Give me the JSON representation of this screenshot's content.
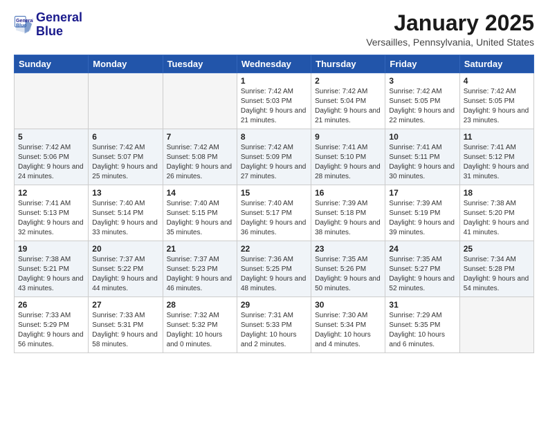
{
  "logo": {
    "line1": "General",
    "line2": "Blue"
  },
  "header": {
    "month": "January 2025",
    "location": "Versailles, Pennsylvania, United States"
  },
  "weekdays": [
    "Sunday",
    "Monday",
    "Tuesday",
    "Wednesday",
    "Thursday",
    "Friday",
    "Saturday"
  ],
  "weeks": [
    [
      {
        "day": "",
        "info": ""
      },
      {
        "day": "",
        "info": ""
      },
      {
        "day": "",
        "info": ""
      },
      {
        "day": "1",
        "info": "Sunrise: 7:42 AM\nSunset: 5:03 PM\nDaylight: 9 hours\nand 21 minutes."
      },
      {
        "day": "2",
        "info": "Sunrise: 7:42 AM\nSunset: 5:04 PM\nDaylight: 9 hours\nand 21 minutes."
      },
      {
        "day": "3",
        "info": "Sunrise: 7:42 AM\nSunset: 5:05 PM\nDaylight: 9 hours\nand 22 minutes."
      },
      {
        "day": "4",
        "info": "Sunrise: 7:42 AM\nSunset: 5:05 PM\nDaylight: 9 hours\nand 23 minutes."
      }
    ],
    [
      {
        "day": "5",
        "info": "Sunrise: 7:42 AM\nSunset: 5:06 PM\nDaylight: 9 hours\nand 24 minutes."
      },
      {
        "day": "6",
        "info": "Sunrise: 7:42 AM\nSunset: 5:07 PM\nDaylight: 9 hours\nand 25 minutes."
      },
      {
        "day": "7",
        "info": "Sunrise: 7:42 AM\nSunset: 5:08 PM\nDaylight: 9 hours\nand 26 minutes."
      },
      {
        "day": "8",
        "info": "Sunrise: 7:42 AM\nSunset: 5:09 PM\nDaylight: 9 hours\nand 27 minutes."
      },
      {
        "day": "9",
        "info": "Sunrise: 7:41 AM\nSunset: 5:10 PM\nDaylight: 9 hours\nand 28 minutes."
      },
      {
        "day": "10",
        "info": "Sunrise: 7:41 AM\nSunset: 5:11 PM\nDaylight: 9 hours\nand 30 minutes."
      },
      {
        "day": "11",
        "info": "Sunrise: 7:41 AM\nSunset: 5:12 PM\nDaylight: 9 hours\nand 31 minutes."
      }
    ],
    [
      {
        "day": "12",
        "info": "Sunrise: 7:41 AM\nSunset: 5:13 PM\nDaylight: 9 hours\nand 32 minutes."
      },
      {
        "day": "13",
        "info": "Sunrise: 7:40 AM\nSunset: 5:14 PM\nDaylight: 9 hours\nand 33 minutes."
      },
      {
        "day": "14",
        "info": "Sunrise: 7:40 AM\nSunset: 5:15 PM\nDaylight: 9 hours\nand 35 minutes."
      },
      {
        "day": "15",
        "info": "Sunrise: 7:40 AM\nSunset: 5:17 PM\nDaylight: 9 hours\nand 36 minutes."
      },
      {
        "day": "16",
        "info": "Sunrise: 7:39 AM\nSunset: 5:18 PM\nDaylight: 9 hours\nand 38 minutes."
      },
      {
        "day": "17",
        "info": "Sunrise: 7:39 AM\nSunset: 5:19 PM\nDaylight: 9 hours\nand 39 minutes."
      },
      {
        "day": "18",
        "info": "Sunrise: 7:38 AM\nSunset: 5:20 PM\nDaylight: 9 hours\nand 41 minutes."
      }
    ],
    [
      {
        "day": "19",
        "info": "Sunrise: 7:38 AM\nSunset: 5:21 PM\nDaylight: 9 hours\nand 43 minutes."
      },
      {
        "day": "20",
        "info": "Sunrise: 7:37 AM\nSunset: 5:22 PM\nDaylight: 9 hours\nand 44 minutes."
      },
      {
        "day": "21",
        "info": "Sunrise: 7:37 AM\nSunset: 5:23 PM\nDaylight: 9 hours\nand 46 minutes."
      },
      {
        "day": "22",
        "info": "Sunrise: 7:36 AM\nSunset: 5:25 PM\nDaylight: 9 hours\nand 48 minutes."
      },
      {
        "day": "23",
        "info": "Sunrise: 7:35 AM\nSunset: 5:26 PM\nDaylight: 9 hours\nand 50 minutes."
      },
      {
        "day": "24",
        "info": "Sunrise: 7:35 AM\nSunset: 5:27 PM\nDaylight: 9 hours\nand 52 minutes."
      },
      {
        "day": "25",
        "info": "Sunrise: 7:34 AM\nSunset: 5:28 PM\nDaylight: 9 hours\nand 54 minutes."
      }
    ],
    [
      {
        "day": "26",
        "info": "Sunrise: 7:33 AM\nSunset: 5:29 PM\nDaylight: 9 hours\nand 56 minutes."
      },
      {
        "day": "27",
        "info": "Sunrise: 7:33 AM\nSunset: 5:31 PM\nDaylight: 9 hours\nand 58 minutes."
      },
      {
        "day": "28",
        "info": "Sunrise: 7:32 AM\nSunset: 5:32 PM\nDaylight: 10 hours\nand 0 minutes."
      },
      {
        "day": "29",
        "info": "Sunrise: 7:31 AM\nSunset: 5:33 PM\nDaylight: 10 hours\nand 2 minutes."
      },
      {
        "day": "30",
        "info": "Sunrise: 7:30 AM\nSunset: 5:34 PM\nDaylight: 10 hours\nand 4 minutes."
      },
      {
        "day": "31",
        "info": "Sunrise: 7:29 AM\nSunset: 5:35 PM\nDaylight: 10 hours\nand 6 minutes."
      },
      {
        "day": "",
        "info": ""
      }
    ]
  ]
}
